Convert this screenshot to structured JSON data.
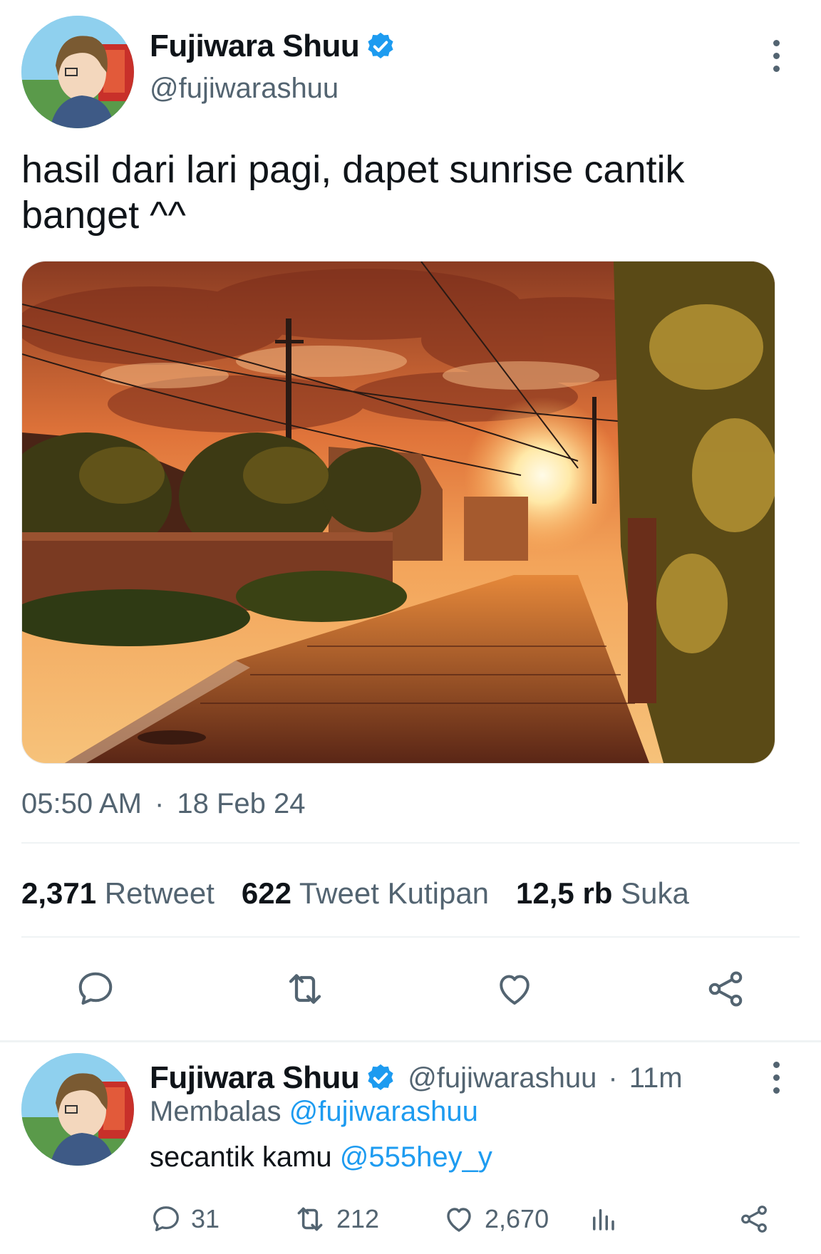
{
  "tweet": {
    "author_name": "Fujiwara Shuu",
    "author_handle": "@fujiwarashuu",
    "text": "hasil dari lari pagi, dapet sunrise cantik banget ^^",
    "time": "05:50 AM",
    "separator": "·",
    "date": "18 Feb 24",
    "stats": {
      "retweets_count": "2,371",
      "retweets_label": "Retweet",
      "quotes_count": "622",
      "quotes_label": "Tweet Kutipan",
      "likes_count": "12,5 rb",
      "likes_label": "Suka"
    },
    "icons": [
      "reply-icon",
      "retweet-icon",
      "like-icon",
      "share-icon"
    ]
  },
  "reply": {
    "author_name": "Fujiwara Shuu",
    "author_handle": "@fujiwarashuu",
    "separator": "·",
    "time_ago": "11m",
    "replying_label": "Membalas",
    "replying_to": "@fujiwarashuu",
    "text": "secantik kamu",
    "mention": "@555hey_y",
    "counts": {
      "replies": "31",
      "retweets": "212",
      "likes": "2,670"
    },
    "icons": [
      "reply-icon",
      "retweet-icon",
      "like-icon",
      "views-icon",
      "share-icon"
    ]
  },
  "colors": {
    "accent": "#1d9bf0",
    "muted": "#536471",
    "text": "#0f1419"
  }
}
